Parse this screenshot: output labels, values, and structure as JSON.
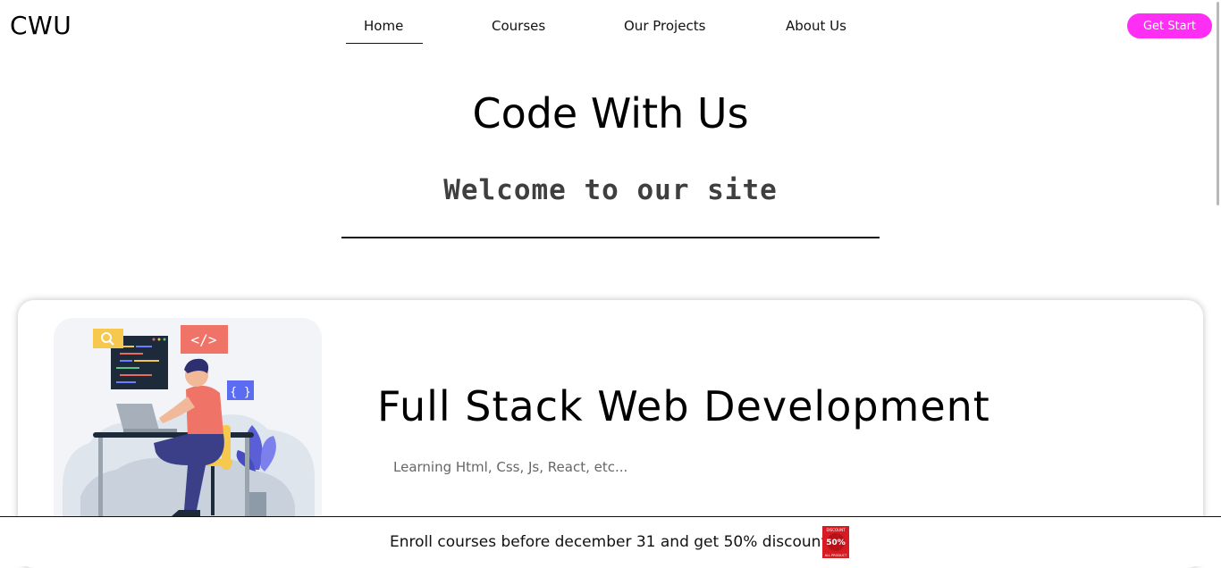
{
  "header": {
    "logo": "CWU",
    "nav": [
      "Home",
      "Courses",
      "Our Projects",
      "About Us"
    ],
    "cta": "Get Start"
  },
  "hero": {
    "title": "Code With Us",
    "subtitle": "Welcome to our site"
  },
  "course_card": {
    "title": "Full Stack Web Development",
    "description": "Learning Html, Css, Js, React, etc...",
    "illustration_icons": [
      "search-icon",
      "code-tag-icon",
      "braces-icon"
    ],
    "code_tag": "</>",
    "braces": "{ }"
  },
  "banner": {
    "text": "Enroll courses before december 31 and get 50% discount",
    "badge": {
      "top": "DISCOUNT",
      "value": "50%",
      "bottom": "ALL PRODUCT"
    }
  },
  "colors": {
    "accent": "#ff2ef4",
    "banner_badge": "#d81b23"
  }
}
